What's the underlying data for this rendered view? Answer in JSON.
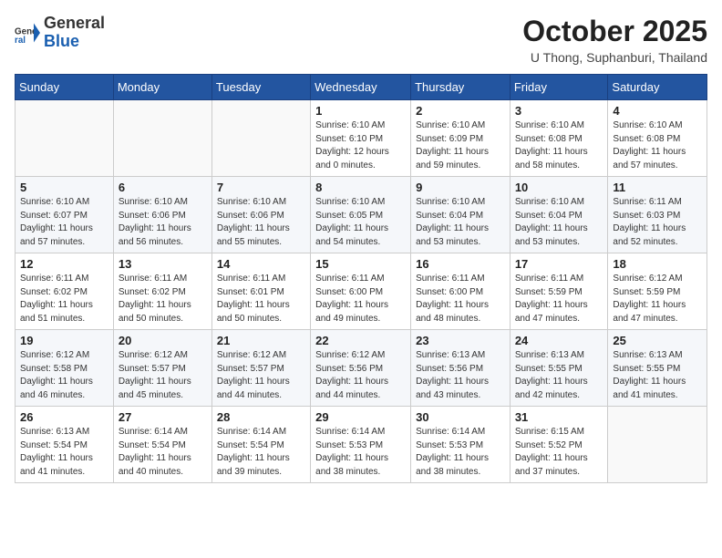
{
  "header": {
    "logo_general": "General",
    "logo_blue": "Blue",
    "month_title": "October 2025",
    "location": "U Thong, Suphanburi, Thailand"
  },
  "days_of_week": [
    "Sunday",
    "Monday",
    "Tuesday",
    "Wednesday",
    "Thursday",
    "Friday",
    "Saturday"
  ],
  "weeks": [
    [
      {
        "day": "",
        "info": ""
      },
      {
        "day": "",
        "info": ""
      },
      {
        "day": "",
        "info": ""
      },
      {
        "day": "1",
        "info": "Sunrise: 6:10 AM\nSunset: 6:10 PM\nDaylight: 12 hours\nand 0 minutes."
      },
      {
        "day": "2",
        "info": "Sunrise: 6:10 AM\nSunset: 6:09 PM\nDaylight: 11 hours\nand 59 minutes."
      },
      {
        "day": "3",
        "info": "Sunrise: 6:10 AM\nSunset: 6:08 PM\nDaylight: 11 hours\nand 58 minutes."
      },
      {
        "day": "4",
        "info": "Sunrise: 6:10 AM\nSunset: 6:08 PM\nDaylight: 11 hours\nand 57 minutes."
      }
    ],
    [
      {
        "day": "5",
        "info": "Sunrise: 6:10 AM\nSunset: 6:07 PM\nDaylight: 11 hours\nand 57 minutes."
      },
      {
        "day": "6",
        "info": "Sunrise: 6:10 AM\nSunset: 6:06 PM\nDaylight: 11 hours\nand 56 minutes."
      },
      {
        "day": "7",
        "info": "Sunrise: 6:10 AM\nSunset: 6:06 PM\nDaylight: 11 hours\nand 55 minutes."
      },
      {
        "day": "8",
        "info": "Sunrise: 6:10 AM\nSunset: 6:05 PM\nDaylight: 11 hours\nand 54 minutes."
      },
      {
        "day": "9",
        "info": "Sunrise: 6:10 AM\nSunset: 6:04 PM\nDaylight: 11 hours\nand 53 minutes."
      },
      {
        "day": "10",
        "info": "Sunrise: 6:10 AM\nSunset: 6:04 PM\nDaylight: 11 hours\nand 53 minutes."
      },
      {
        "day": "11",
        "info": "Sunrise: 6:11 AM\nSunset: 6:03 PM\nDaylight: 11 hours\nand 52 minutes."
      }
    ],
    [
      {
        "day": "12",
        "info": "Sunrise: 6:11 AM\nSunset: 6:02 PM\nDaylight: 11 hours\nand 51 minutes."
      },
      {
        "day": "13",
        "info": "Sunrise: 6:11 AM\nSunset: 6:02 PM\nDaylight: 11 hours\nand 50 minutes."
      },
      {
        "day": "14",
        "info": "Sunrise: 6:11 AM\nSunset: 6:01 PM\nDaylight: 11 hours\nand 50 minutes."
      },
      {
        "day": "15",
        "info": "Sunrise: 6:11 AM\nSunset: 6:00 PM\nDaylight: 11 hours\nand 49 minutes."
      },
      {
        "day": "16",
        "info": "Sunrise: 6:11 AM\nSunset: 6:00 PM\nDaylight: 11 hours\nand 48 minutes."
      },
      {
        "day": "17",
        "info": "Sunrise: 6:11 AM\nSunset: 5:59 PM\nDaylight: 11 hours\nand 47 minutes."
      },
      {
        "day": "18",
        "info": "Sunrise: 6:12 AM\nSunset: 5:59 PM\nDaylight: 11 hours\nand 47 minutes."
      }
    ],
    [
      {
        "day": "19",
        "info": "Sunrise: 6:12 AM\nSunset: 5:58 PM\nDaylight: 11 hours\nand 46 minutes."
      },
      {
        "day": "20",
        "info": "Sunrise: 6:12 AM\nSunset: 5:57 PM\nDaylight: 11 hours\nand 45 minutes."
      },
      {
        "day": "21",
        "info": "Sunrise: 6:12 AM\nSunset: 5:57 PM\nDaylight: 11 hours\nand 44 minutes."
      },
      {
        "day": "22",
        "info": "Sunrise: 6:12 AM\nSunset: 5:56 PM\nDaylight: 11 hours\nand 44 minutes."
      },
      {
        "day": "23",
        "info": "Sunrise: 6:13 AM\nSunset: 5:56 PM\nDaylight: 11 hours\nand 43 minutes."
      },
      {
        "day": "24",
        "info": "Sunrise: 6:13 AM\nSunset: 5:55 PM\nDaylight: 11 hours\nand 42 minutes."
      },
      {
        "day": "25",
        "info": "Sunrise: 6:13 AM\nSunset: 5:55 PM\nDaylight: 11 hours\nand 41 minutes."
      }
    ],
    [
      {
        "day": "26",
        "info": "Sunrise: 6:13 AM\nSunset: 5:54 PM\nDaylight: 11 hours\nand 41 minutes."
      },
      {
        "day": "27",
        "info": "Sunrise: 6:14 AM\nSunset: 5:54 PM\nDaylight: 11 hours\nand 40 minutes."
      },
      {
        "day": "28",
        "info": "Sunrise: 6:14 AM\nSunset: 5:54 PM\nDaylight: 11 hours\nand 39 minutes."
      },
      {
        "day": "29",
        "info": "Sunrise: 6:14 AM\nSunset: 5:53 PM\nDaylight: 11 hours\nand 38 minutes."
      },
      {
        "day": "30",
        "info": "Sunrise: 6:14 AM\nSunset: 5:53 PM\nDaylight: 11 hours\nand 38 minutes."
      },
      {
        "day": "31",
        "info": "Sunrise: 6:15 AM\nSunset: 5:52 PM\nDaylight: 11 hours\nand 37 minutes."
      },
      {
        "day": "",
        "info": ""
      }
    ]
  ]
}
